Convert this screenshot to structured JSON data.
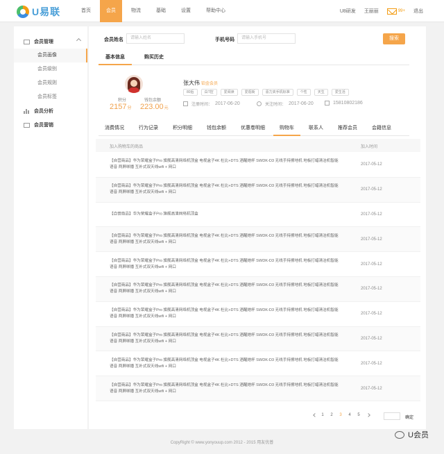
{
  "topbar": {
    "logo_text": "U易联",
    "nav": [
      "首页",
      "会员",
      "物流",
      "基础",
      "设置",
      "帮助中心"
    ],
    "active_nav": 1,
    "user_unit": "U8研发",
    "user_name": "王丽丽",
    "mail_count": "99+",
    "logout": "退出"
  },
  "sidebar": {
    "group_manage": "会员管理",
    "items": [
      "会员画像",
      "会员级别",
      "会员规则",
      "会员标签"
    ],
    "active_item": 0,
    "group_analysis": "会员分析",
    "group_marketing": "会员营销"
  },
  "search": {
    "name_label": "会员姓名",
    "name_placeholder": "请输入姓名",
    "phone_label": "手机号码",
    "phone_placeholder": "请输入手机号",
    "button": "搜索"
  },
  "tabs_top": [
    "基本信息",
    "购买历史"
  ],
  "profile": {
    "points_label": "积分",
    "points_value": "2157",
    "points_unit": "分",
    "wallet_label": "钱包余额",
    "wallet_value": "223.00",
    "wallet_unit": "元",
    "name": "张大伟",
    "level": "铂金会员",
    "tags": [
      "80后",
      "白T控",
      "爱阅读",
      "爱逛街",
      "喜力夹手机标准",
      "个性",
      "天生",
      "爱生活"
    ],
    "register_label": "注册时间：",
    "register_date": "2017-06-20",
    "follow_label": "关注时间：",
    "follow_date": "2017-06-20",
    "phone": "15810802186"
  },
  "tabs_detail": [
    "消费情况",
    "行为记录",
    "积分明细",
    "钱包余额",
    "优惠卷明细",
    "购物车",
    "联系人",
    "推荐会员",
    "会籍信息"
  ],
  "active_detail_tab": 5,
  "table": {
    "col_product": "加入购物车的商品",
    "col_time": "加入时间",
    "rows": [
      {
        "name": "【自营商品】华为荣耀盒子Pro 旗舰高清网络机顶盒 电视盒子4K 杜比+DTS 酒醒她杯 SWDK-D3 无线手持擦地机 地板打蜡清洁机智能语音 两屏绑播 互补式双天线wifi + 网口",
        "date": "2017-05-12"
      },
      {
        "name": "【自营商品】华为荣耀盒子Pro 旗舰高清网络机顶盒 电视盒子4K 杜比+DTS 酒醒她杯 SWDK-D3 无线手持擦地机 地板打蜡清洁机智能语音 两屏绑播 互补式双天线wifi + 网口",
        "date": "2017-05-12"
      },
      {
        "name": "【自营商品】华为荣耀盒子Pro 旗舰高清网络机顶盒",
        "date": "2017-05-12"
      },
      {
        "name": "【自营商品】华为荣耀盒子Pro 旗舰高清网络机顶盒 电视盒子4K 杜比+DTS 酒醒她杯 SWDK-D3 无线手持擦地机 地板打蜡清洁机智能语音 两屏绑播 互补式双天线wifi + 网口",
        "date": "2017-05-12"
      },
      {
        "name": "【自营商品】华为荣耀盒子Pro 旗舰高清网络机顶盒 电视盒子4K 杜比+DTS 酒醒她杯 SWDK-D3 无线手持擦地机 地板打蜡清洁机智能语音 两屏绑播 互补式双天线wifi + 网口",
        "date": "2017-05-12"
      },
      {
        "name": "【自营商品】华为荣耀盒子Pro 旗舰高清网络机顶盒 电视盒子4K 杜比+DTS 酒醒她杯 SWDK-D3 无线手持擦地机 地板打蜡清洁机智能语音 两屏绑播 互补式双天线wifi + 网口",
        "date": "2017-05-12"
      },
      {
        "name": "【自营商品】华为荣耀盒子Pro 旗舰高清网络机顶盒 电视盒子4K 杜比+DTS 酒醒她杯 SWDK-D3 无线手持擦地机 地板打蜡清洁机智能语音 两屏绑播 互补式双天线wifi + 网口",
        "date": "2017-05-12"
      },
      {
        "name": "【自营商品】华为荣耀盒子Pro 旗舰高清网络机顶盒 电视盒子4K 杜比+DTS 酒醒她杯 SWDK-D3 无线手持擦地机 地板打蜡清洁机智能语音 两屏绑播 互补式双天线wifi + 网口",
        "date": "2017-05-12"
      },
      {
        "name": "【自营商品】华为荣耀盒子Pro 旗舰高清网络机顶盒 电视盒子4K 杜比+DTS 酒醒她杯 SWDK-D3 无线手持擦地机 地板打蜡清洁机智能语音 两屏绑播 互补式双天线wifi + 网口",
        "date": "2017-05-12"
      },
      {
        "name": "【自营商品】华为荣耀盒子Pro 旗舰高清网络机顶盒 电视盒子4K 杜比+DTS 酒醒她杯 SWDK-D3 无线手持擦地机 地板打蜡清洁机智能语音 两屏绑播 互补式双天线wifi + 网口",
        "date": "2017-05-12"
      }
    ]
  },
  "pagination": {
    "pages": [
      "1",
      "2",
      "3",
      "4",
      "5"
    ],
    "active_page": 2,
    "goto_button": "确定"
  },
  "footer": {
    "copyright": "CopyRight © www.yonyouup.com 2012 - 2015 用友优普",
    "watermark": "U会员"
  },
  "colors": {
    "accent": "#f5a54a",
    "panel": "#ffffff",
    "background": "#f2f2f2"
  }
}
